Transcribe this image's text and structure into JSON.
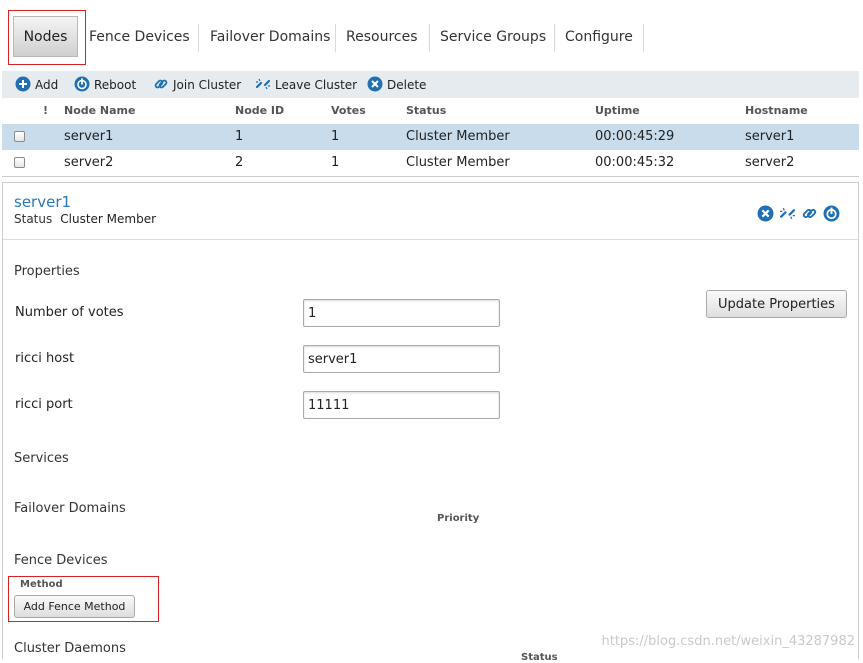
{
  "tabs": [
    {
      "label": "Nodes",
      "active": true
    },
    {
      "label": "Fence Devices"
    },
    {
      "label": "Failover Domains"
    },
    {
      "label": "Resources"
    },
    {
      "label": "Service Groups"
    },
    {
      "label": "Configure"
    }
  ],
  "toolbar": {
    "add": "Add",
    "reboot": "Reboot",
    "join_cluster": "Join Cluster",
    "leave_cluster": "Leave Cluster",
    "delete": "Delete"
  },
  "table": {
    "headers": {
      "flag": "!",
      "node_name": "Node Name",
      "node_id": "Node ID",
      "votes": "Votes",
      "status": "Status",
      "uptime": "Uptime",
      "hostname": "Hostname"
    },
    "rows": [
      {
        "node_name": "server1",
        "node_id": "1",
        "votes": "1",
        "status": "Cluster Member",
        "uptime": "00:00:45:29",
        "hostname": "server1",
        "selected": true
      },
      {
        "node_name": "server2",
        "node_id": "2",
        "votes": "1",
        "status": "Cluster Member",
        "uptime": "00:00:45:32",
        "hostname": "server2",
        "selected": false
      }
    ]
  },
  "detail": {
    "title": "server1",
    "status_label": "Status",
    "status_value": "Cluster Member",
    "properties_heading": "Properties",
    "votes_label": "Number of votes",
    "votes_value": "1",
    "ricci_host_label": "ricci host",
    "ricci_host_value": "server1",
    "ricci_port_label": "ricci port",
    "ricci_port_value": "11111",
    "update_button": "Update Properties",
    "services_heading": "Services",
    "failover_heading": "Failover Domains",
    "priority_col": "Priority",
    "fence_heading": "Fence Devices",
    "method_col": "Method",
    "add_fence_button": "Add Fence Method",
    "daemons_heading": "Cluster Daemons",
    "daemons_status_col": "Status"
  },
  "watermark": "https://blog.csdn.net/weixin_43287982",
  "colors": {
    "accent": "#2a79b8",
    "selected_row": "#c8dcec",
    "highlight_box": "#d62222"
  }
}
